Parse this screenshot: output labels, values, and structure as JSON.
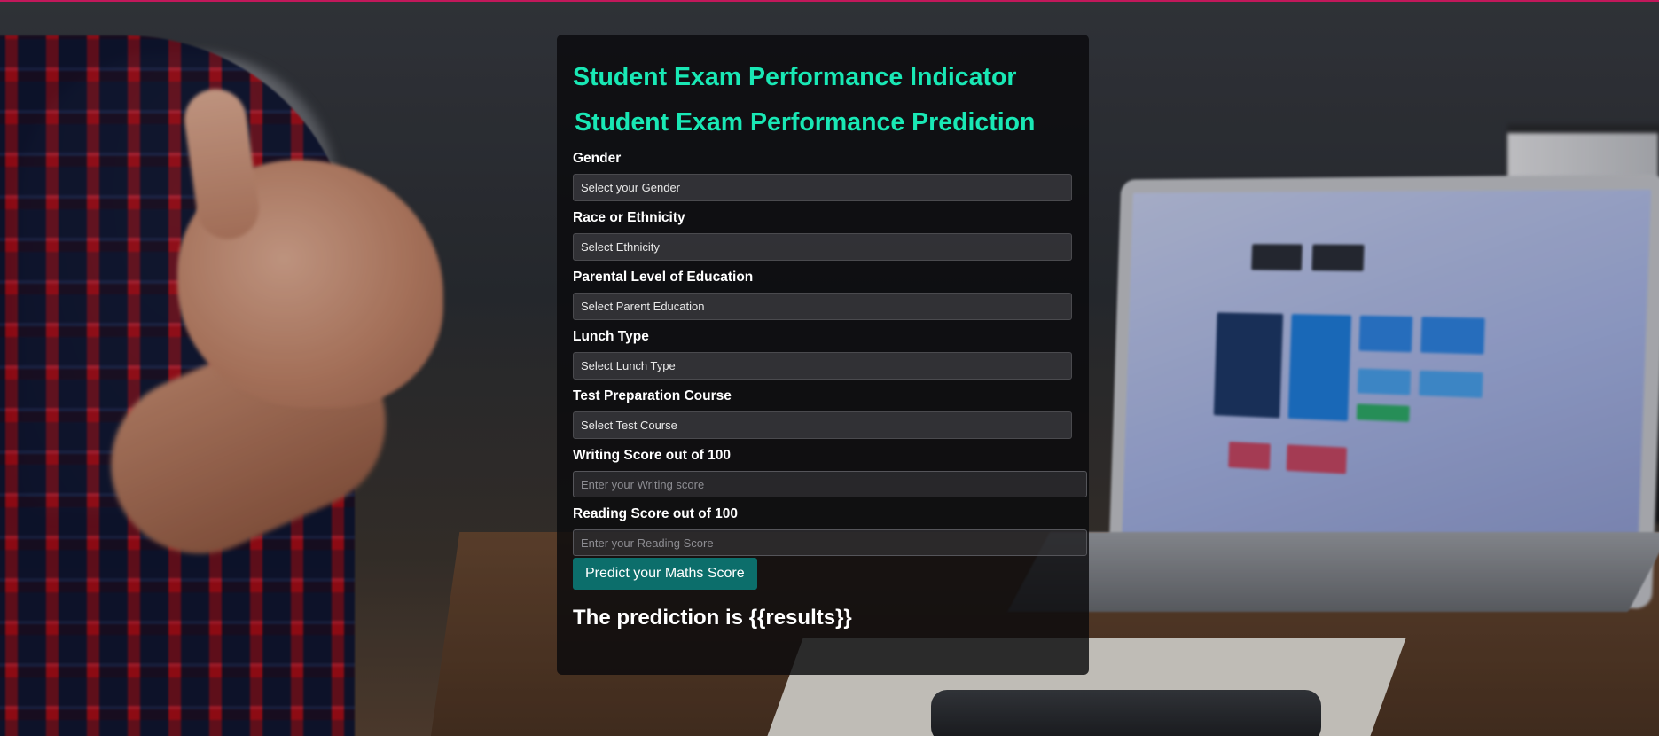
{
  "page": {
    "title": "Student Exam Performance Indicator",
    "form_title": "Student Exam Performance Prediction",
    "accent_color": "#19e8b5",
    "button_color": "#0c6e6b"
  },
  "form": {
    "gender": {
      "label": "Gender",
      "selected": "Select your Gender"
    },
    "ethnicity": {
      "label": "Race or Ethnicity",
      "selected": "Select Ethnicity"
    },
    "parental_education": {
      "label": "Parental Level of Education",
      "selected": "Select Parent Education"
    },
    "lunch": {
      "label": "Lunch Type",
      "selected": "Select Lunch Type"
    },
    "test_prep": {
      "label": "Test Preparation Course",
      "selected": "Select Test Course"
    },
    "writing_score": {
      "label": "Writing Score out of 100",
      "placeholder": "Enter your Writing score"
    },
    "reading_score": {
      "label": "Reading Score out of 100",
      "placeholder": "Enter your Reading Score"
    },
    "submit_label": "Predict your Maths Score"
  },
  "result": {
    "text": "The prediction is {{results}}"
  }
}
